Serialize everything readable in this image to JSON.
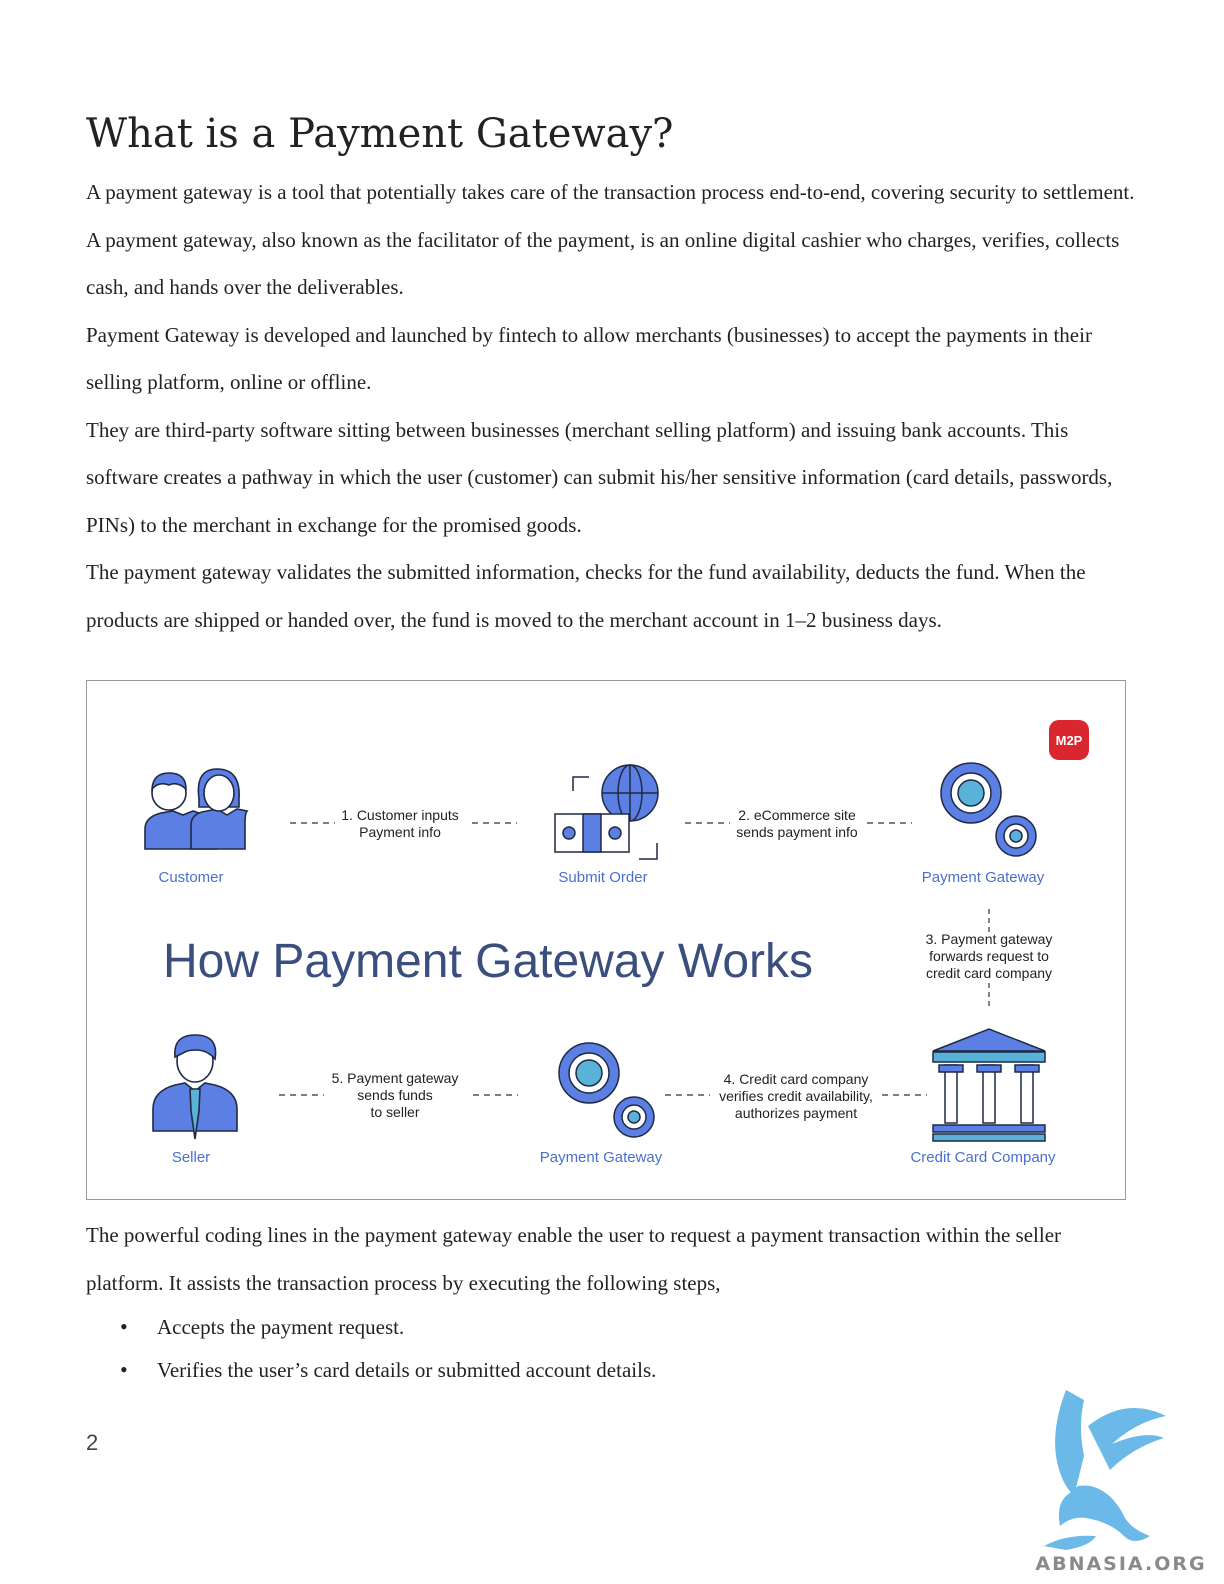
{
  "title": "What is a Payment Gateway?",
  "intro_paragraphs": [
    "A payment gateway is a tool that potentially takes care of the transaction process end-to-end, covering security to settlement. A payment gateway, also known as the facilitator of the payment, is an online digital cashier who charges, verifies, collects cash, and hands over the deliverables.",
    "Payment Gateway is developed and launched by fintech to allow merchants (businesses) to accept the payments in their selling platform, online or offline.",
    "They are third-party software sitting between businesses (merchant selling platform) and issuing bank accounts. This software creates a pathway in which the user (customer) can submit his/her sensitive information (card details, passwords, PINs) to the merchant in exchange for the promised goods.",
    "The payment gateway validates the submitted information, checks for the fund availability, deducts the fund. When the products are shipped or handed over, the fund is moved to the merchant account in 1–2 business days."
  ],
  "figure": {
    "heading": "How Payment Gateway Works",
    "badge": "M2P",
    "nodes": {
      "customer": "Customer",
      "submit_order": "Submit Order",
      "payment_gateway_top": "Payment Gateway",
      "seller": "Seller",
      "payment_gateway_bottom": "Payment Gateway",
      "credit_card_company": "Credit Card Company"
    },
    "steps": {
      "step1": [
        "1. Customer inputs",
        "Payment info"
      ],
      "step2": [
        "2. eCommerce site",
        "sends payment info"
      ],
      "step3": [
        "3. Payment gateway",
        "forwards request to",
        "credit card company"
      ],
      "step4": [
        "4. Credit card company",
        "verifies credit availability,",
        "authorizes payment"
      ],
      "step5": [
        "5. Payment gateway",
        "sends funds",
        "to seller"
      ]
    },
    "colors": {
      "label_blue": "#4a6fd0",
      "icon_blue": "#5b7fe3",
      "heading_navy": "#3b4f7f",
      "badge_red": "#d9262f"
    }
  },
  "after_paragraph": "The powerful coding lines in the payment gateway enable the user to request a payment transaction within the seller platform. It assists the transaction process by executing the following steps,",
  "steps_list": [
    "Accepts the payment request.",
    "Verifies the user’s card details or submitted account details."
  ],
  "page_number": "2",
  "watermark_text": "ABNASIA.ORG"
}
